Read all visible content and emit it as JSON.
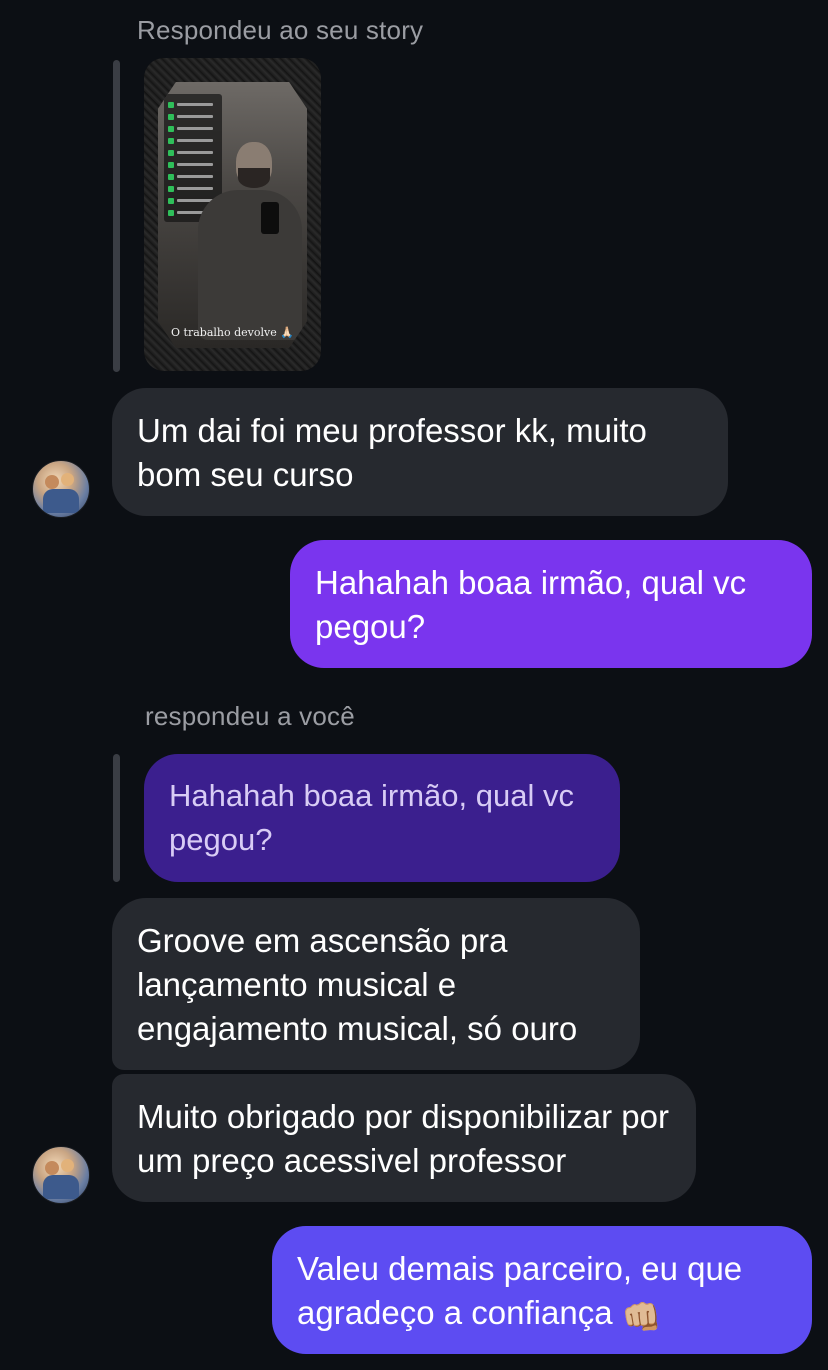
{
  "story_reply": {
    "label": "Respondeu ao seu story",
    "story_caption": "O trabalho devolve 🙏🏻"
  },
  "messages": [
    {
      "id": "m1",
      "direction": "incoming",
      "text": "Um dai foi meu professor kk, muito bom seu curso"
    },
    {
      "id": "m2",
      "direction": "outgoing",
      "text": "Hahahah boaa irmão, qual vc pegou?"
    },
    {
      "id": "m3",
      "direction": "incoming",
      "text": "Groove em ascensão pra lançamento musical e engajamento musical, só ouro"
    },
    {
      "id": "m4",
      "direction": "incoming",
      "text": "Muito obrigado por disponibilizar por um preço acessivel professor"
    },
    {
      "id": "m5",
      "direction": "outgoing",
      "text": "Valeu demais parceiro, eu que agradeço a confiança",
      "emoji": "👊🏼"
    }
  ],
  "reply_context": {
    "label": "respondeu a você",
    "quoted_text": "Hahahah boaa irmão, qual vc pegou?"
  },
  "colors": {
    "background": "#0c0f14",
    "incoming_bubble": "#26292f",
    "outgoing_bubble": "#7a35ee",
    "outgoing_bubble_2": "#5d4cf2",
    "quoted_bubble": "#3b1f8e"
  }
}
